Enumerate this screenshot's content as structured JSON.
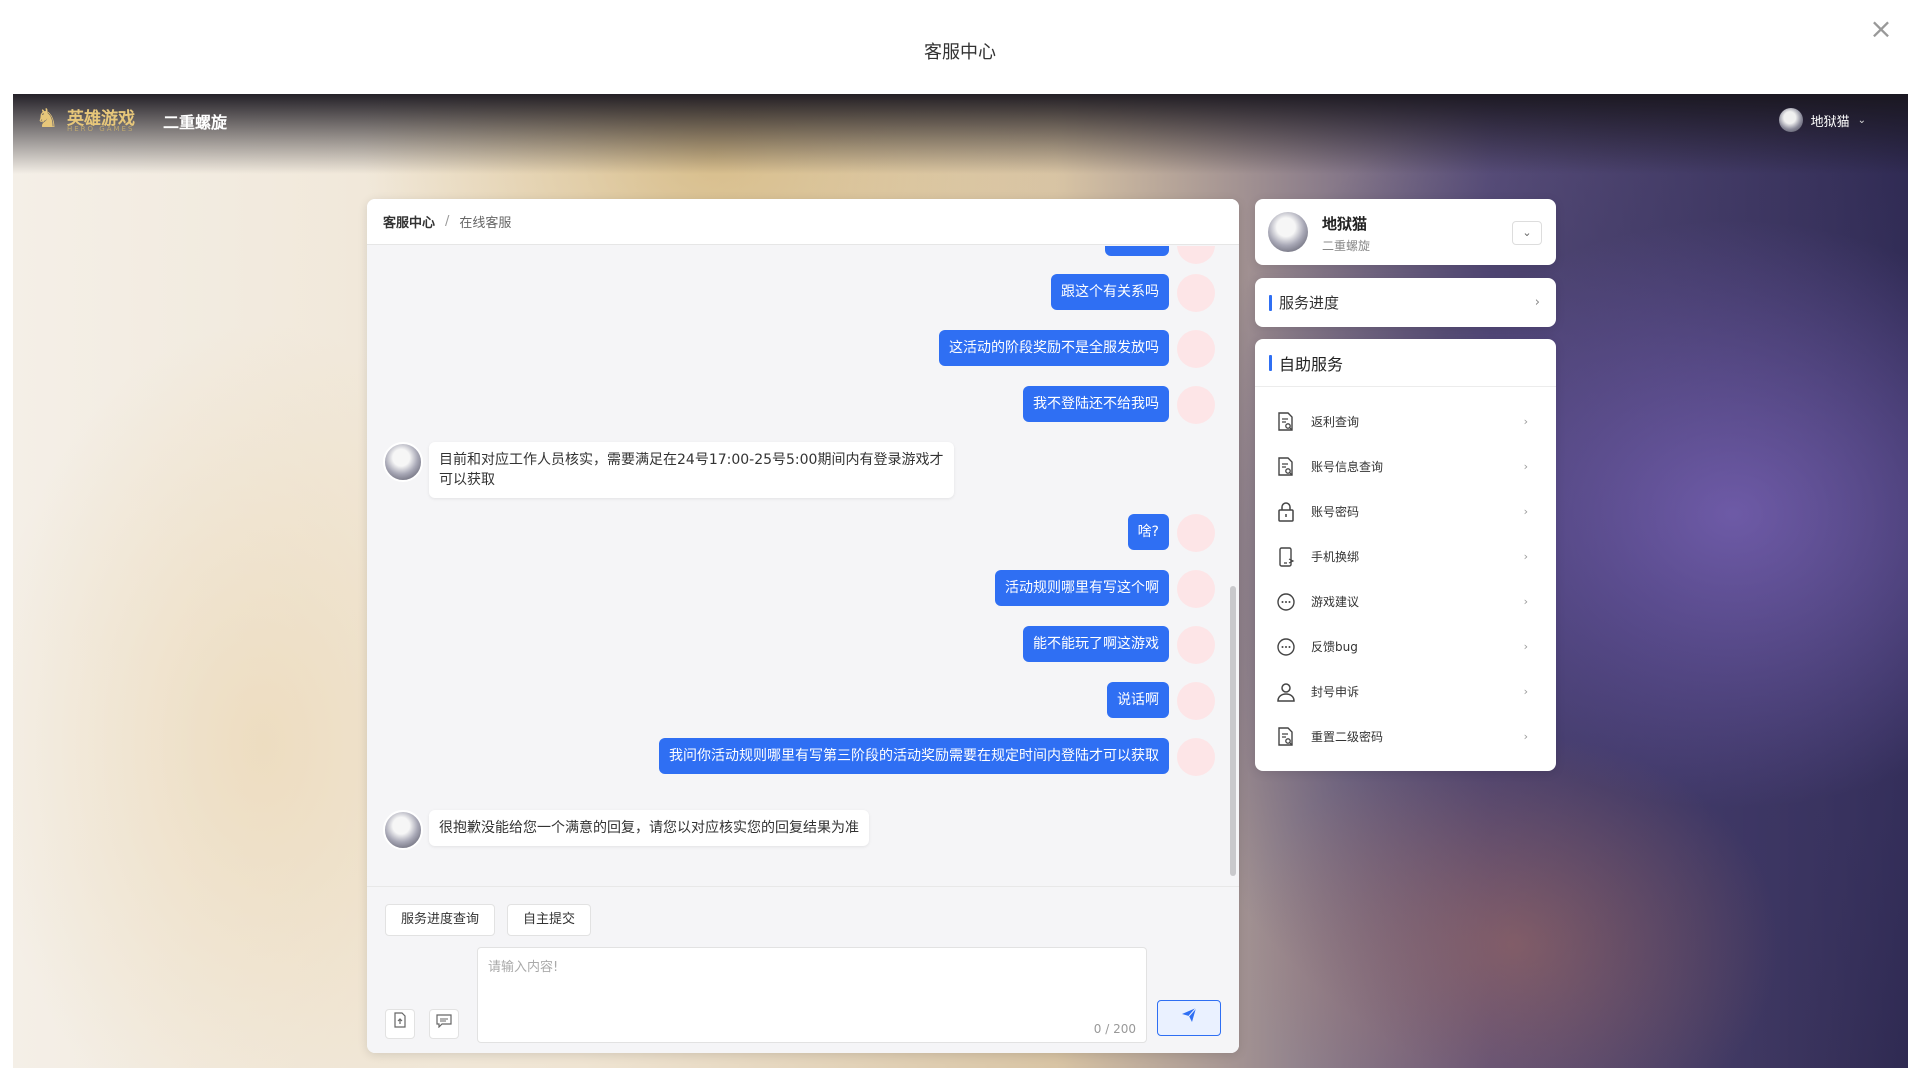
{
  "modal": {
    "title": "客服中心",
    "close_glyph": "×"
  },
  "topbar": {
    "brand_name": "英雄游戏",
    "brand_sub": "HERO GAMES",
    "game_name": "二重螺旋",
    "username": "地狱猫"
  },
  "breadcrumb": {
    "home": "客服中心",
    "separator": "/",
    "current": "在线客服"
  },
  "messages": [
    {
      "from": "user",
      "text": "跟这个有关系吗"
    },
    {
      "from": "user",
      "text": "这活动的阶段奖励不是全服发放吗"
    },
    {
      "from": "user",
      "text": "我不登陆还不给我吗"
    },
    {
      "from": "agent",
      "text": "目前和对应工作人员核实，需要满足在24号17:00-25号5:00期间内有登录游戏才可以获取"
    },
    {
      "from": "user",
      "text": "啥?"
    },
    {
      "from": "user",
      "text": "活动规则哪里有写这个啊"
    },
    {
      "from": "user",
      "text": "能不能玩了啊这游戏"
    },
    {
      "from": "user",
      "text": "说话啊"
    },
    {
      "from": "user",
      "text": "我问你活动规则哪里有写第三阶段的活动奖励需要在规定时间内登陆才可以获取"
    },
    {
      "from": "agent",
      "text": "很抱歉没能给您一个满意的回复，请您以对应核实您的回复结果为准"
    }
  ],
  "input": {
    "quick_progress": "服务进度查询",
    "quick_submit": "自主提交",
    "placeholder": "请输入内容!",
    "value": "",
    "counter": "0 / 200"
  },
  "profile": {
    "name": "地狱猫",
    "game": "二重螺旋"
  },
  "progress_card": {
    "label": "服务进度"
  },
  "self_service": {
    "title": "自助服务",
    "items": [
      {
        "label": "返利查询",
        "icon": "document-search-icon"
      },
      {
        "label": "账号信息查询",
        "icon": "document-search-icon"
      },
      {
        "label": "账号密码",
        "icon": "lock-icon"
      },
      {
        "label": "手机换绑",
        "icon": "phone-icon"
      },
      {
        "label": "游戏建议",
        "icon": "chat-bubble-icon"
      },
      {
        "label": "反馈bug",
        "icon": "chat-bubble-icon"
      },
      {
        "label": "封号申诉",
        "icon": "user-icon"
      },
      {
        "label": "重置二级密码",
        "icon": "document-search-icon"
      }
    ]
  },
  "colors": {
    "accent": "#2f6ff3",
    "user_avatar_bg": "#fde5e7"
  }
}
